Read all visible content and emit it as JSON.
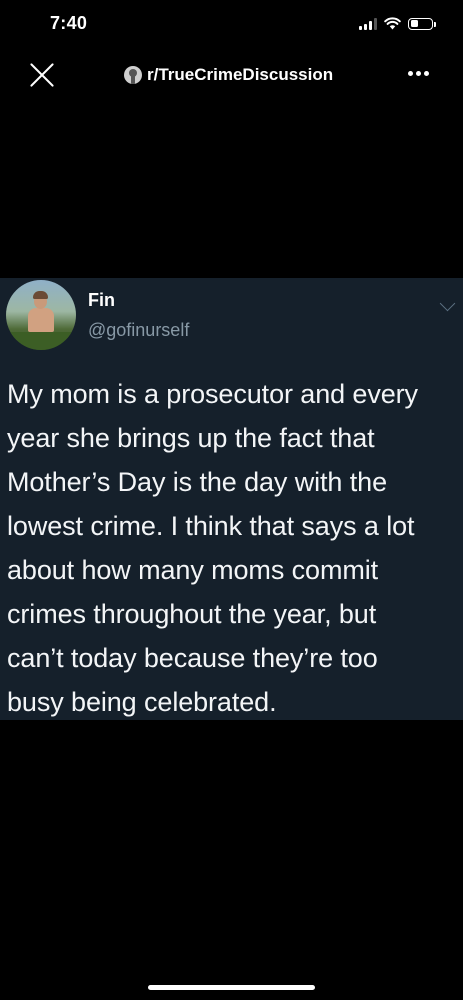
{
  "status_bar": {
    "time": "7:40",
    "signal_bars": 3,
    "battery_level": 0.35
  },
  "nav": {
    "close_icon": "close-icon",
    "community_icon": "community-avatar-icon",
    "community_name": "r/TrueCrimeDiscussion",
    "more_icon": "more-horizontal-icon"
  },
  "tweet": {
    "display_name": "Fin",
    "handle": "@gofinurself",
    "text": "My mom is a prosecutor and every\nyear she brings up the fact that\nMother’s Day is the day with the\nlowest crime. I think that says a lot\nabout how many moms commit\ncrimes throughout the year, but\ncan’t today because they’re too\nbusy being celebrated.",
    "card_color": "#15202b",
    "handle_color": "#8899a6"
  }
}
